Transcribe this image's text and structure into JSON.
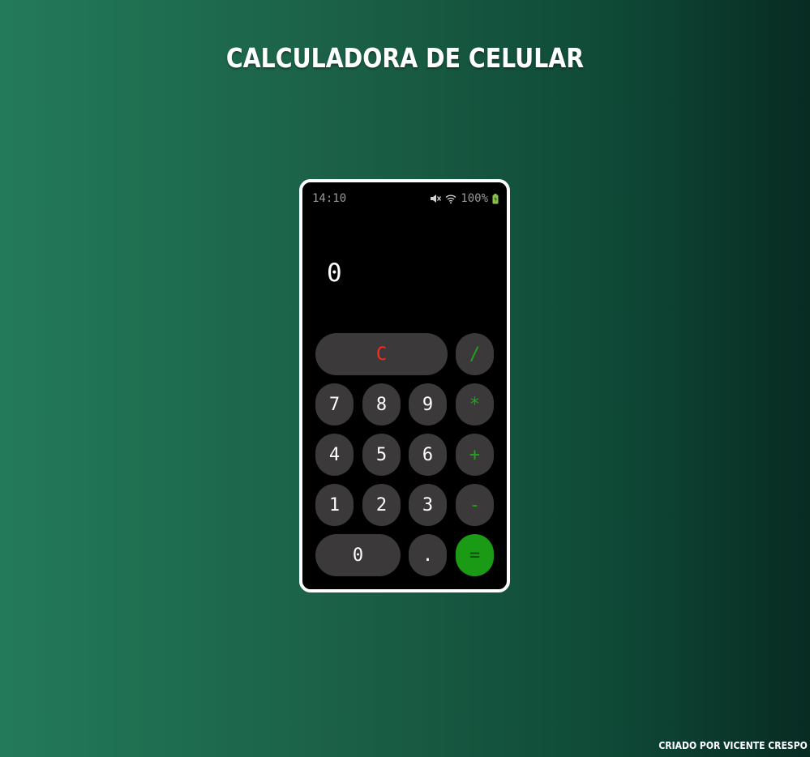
{
  "page": {
    "title": "CALCULADORA DE CELULAR",
    "credit": "CRIADO POR VICENTE CRESPO"
  },
  "status_bar": {
    "time": "14:10",
    "battery_percent": "100%",
    "icons": [
      "mute-icon",
      "wifi-icon",
      "battery-icon"
    ]
  },
  "display": {
    "value": "0"
  },
  "keys": {
    "clear": "C",
    "divide": "/",
    "multiply": "*",
    "add": "+",
    "subtract": "-",
    "equals": "=",
    "decimal": ".",
    "d0": "0",
    "d1": "1",
    "d2": "2",
    "d3": "3",
    "d4": "4",
    "d5": "5",
    "d6": "6",
    "d7": "7",
    "d8": "8",
    "d9": "9"
  },
  "colors": {
    "background_start": "#237a5a",
    "background_end": "#082b22",
    "key_bg": "#3b3939",
    "operator": "#1fa51c",
    "clear": "#ff2a1f",
    "equals_bg": "#1b9a15"
  }
}
